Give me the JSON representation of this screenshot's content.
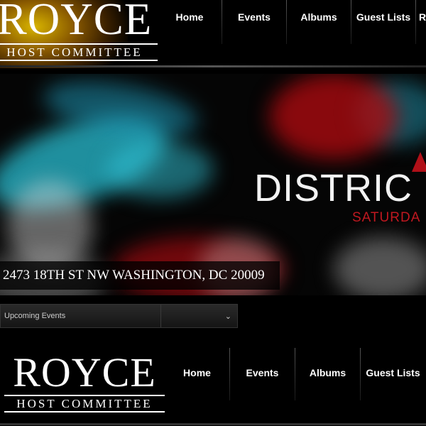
{
  "brand": {
    "name": "ROYCE",
    "tagline": "HOST COMMITTEE"
  },
  "nav": {
    "items": [
      "Home",
      "Events",
      "Albums",
      "Guest Lists",
      "R"
    ]
  },
  "banner": {
    "title": "DISTRIC",
    "subtitle": "SATURDA",
    "address": "2473 18TH ST NW WASHINGTON, DC 20009"
  },
  "dropdown": {
    "selected": "Upcoming Events",
    "icon": "chevron-down-icon"
  },
  "lower_nav": {
    "items": [
      "Home",
      "Events",
      "Albums",
      "Guest Lists"
    ]
  },
  "colors": {
    "background": "#000000",
    "accent_red": "#c01820",
    "smoke_cyan": "#28bed2"
  }
}
